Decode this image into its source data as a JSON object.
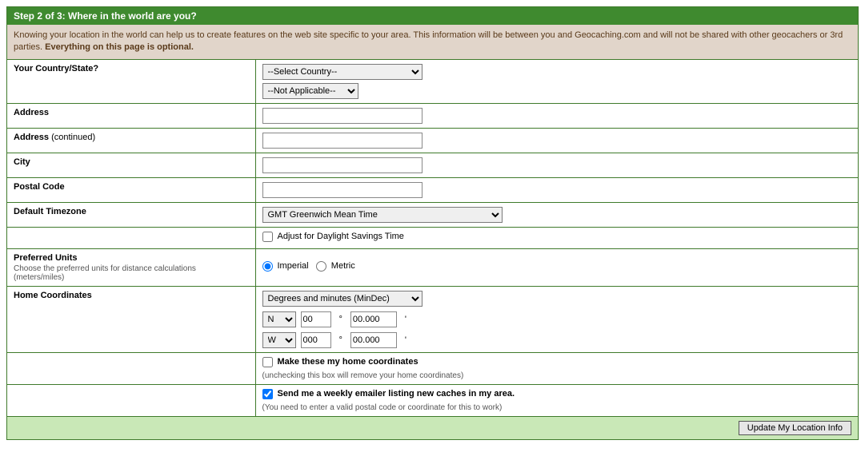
{
  "header": {
    "title": "Step 2 of 3: Where in the world are you?"
  },
  "intro": {
    "text": "Knowing your location in the world can help us to create features on the web site specific to your area. This information will be between you and Geocaching.com and will not be shared with other geocachers or 3rd parties. ",
    "bold": "Everything on this page is optional."
  },
  "labels": {
    "country": "Your Country/State?",
    "address": "Address",
    "address2_prefix": "Address",
    "address2_suffix": " (continued)",
    "city": "City",
    "postal": "Postal Code",
    "timezone": "Default Timezone",
    "units": "Preferred Units",
    "units_sub": "Choose the preferred units for distance calculations (meters/miles)",
    "homecoord": "Home Coordinates"
  },
  "fields": {
    "country_placeholder": "--Select Country--",
    "state_placeholder": "--Not Applicable--",
    "address_value": "",
    "address2_value": "",
    "city_value": "",
    "postal_value": "",
    "timezone_value": "GMT Greenwich Mean Time",
    "dst_label": "Adjust for Daylight Savings Time",
    "units_imperial": "Imperial",
    "units_metric": "Metric",
    "coord_format": "Degrees and minutes (MinDec)",
    "lat_dir": "N",
    "lat_deg": "00",
    "lat_min": "00.000",
    "lon_dir": "W",
    "lon_deg": "000",
    "lon_min": "00.000",
    "deg_symbol": "°",
    "min_symbol": "'",
    "make_home_label": "Make these my home coordinates",
    "make_home_hint": "(unchecking this box will remove your home coordinates)",
    "weekly_label": "Send me a weekly emailer listing new caches in my area.",
    "weekly_hint": "(You need to enter a valid postal code or coordinate for this to work)"
  },
  "submit": {
    "label": "Update My Location Info"
  }
}
